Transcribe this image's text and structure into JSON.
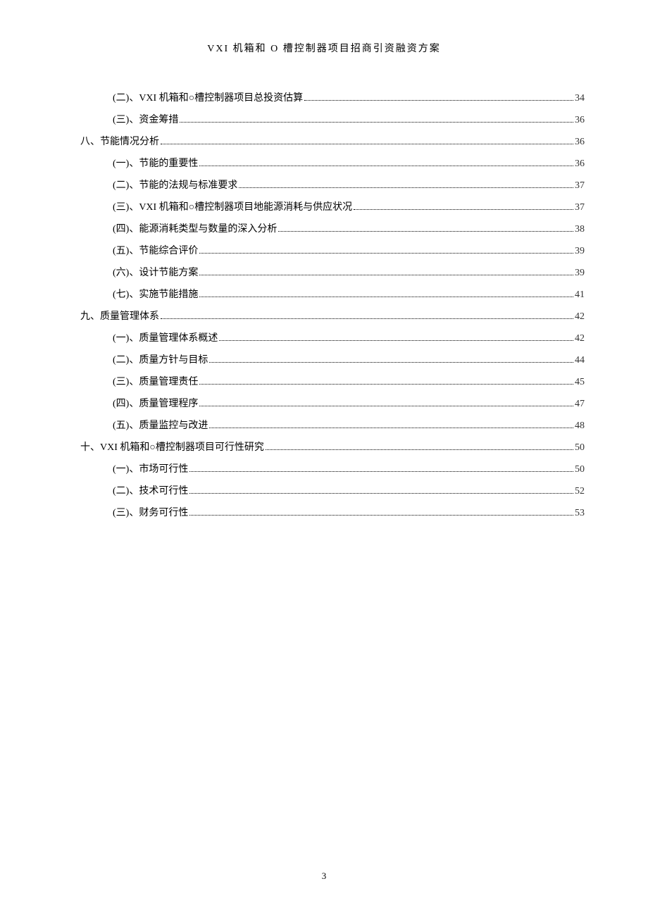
{
  "header": {
    "title": "VXI 机箱和 O 槽控制器项目招商引资融资方案"
  },
  "toc": [
    {
      "level": 2,
      "label": "(二)、VXI 机箱和○槽控制器项目总投资估算",
      "page": "34"
    },
    {
      "level": 2,
      "label": "(三)、资金筹措",
      "page": "36"
    },
    {
      "level": 1,
      "label": "八、节能情况分析",
      "page": "36"
    },
    {
      "level": 2,
      "label": "(一)、节能的重要性",
      "page": "36"
    },
    {
      "level": 2,
      "label": "(二)、节能的法规与标准要求",
      "page": "37"
    },
    {
      "level": 2,
      "label": "(三)、VXI 机箱和○槽控制器项目地能源消耗与供应状况",
      "page": "37"
    },
    {
      "level": 2,
      "label": "(四)、能源消耗类型与数量的深入分析",
      "page": "38"
    },
    {
      "level": 2,
      "label": "(五)、节能综合评价",
      "page": "39"
    },
    {
      "level": 2,
      "label": "(六)、设计节能方案",
      "page": "39"
    },
    {
      "level": 2,
      "label": "(七)、实施节能措施",
      "page": "41"
    },
    {
      "level": 1,
      "label": "九、质量管理体系",
      "page": "42"
    },
    {
      "level": 2,
      "label": "(一)、质量管理体系概述",
      "page": "42"
    },
    {
      "level": 2,
      "label": "(二)、质量方针与目标",
      "page": "44"
    },
    {
      "level": 2,
      "label": "(三)、质量管理责任",
      "page": "45"
    },
    {
      "level": 2,
      "label": "(四)、质量管理程序",
      "page": "47"
    },
    {
      "level": 2,
      "label": "(五)、质量监控与改进",
      "page": "48"
    },
    {
      "level": 1,
      "label": "十、VXI 机箱和○槽控制器项目可行性研究",
      "page": "50"
    },
    {
      "level": 2,
      "label": "(一)、市场可行性",
      "page": "50"
    },
    {
      "level": 2,
      "label": "(二)、技术可行性",
      "page": "52"
    },
    {
      "level": 2,
      "label": "(三)、财务可行性",
      "page": "53"
    }
  ],
  "footer": {
    "page_number": "3"
  }
}
